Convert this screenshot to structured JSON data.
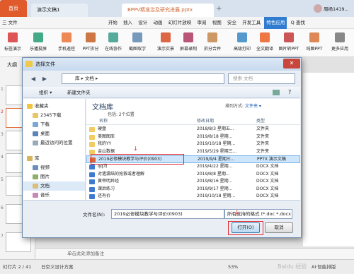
{
  "tabs": [
    {
      "label": "首页"
    },
    {
      "label": "演示文稿1"
    },
    {
      "label": "BPPV精准治及研究进展.pptx"
    }
  ],
  "user": "周扬1419...",
  "menu": [
    "三 文件",
    "开始",
    "插入",
    "设计",
    "动画",
    "幻灯片放映",
    "审阅",
    "视图",
    "安全",
    "开发工具",
    "特色应用",
    "Q 查找"
  ],
  "ribbon": [
    "标签演示",
    "乐播投屏",
    "手机遥控",
    "PPT拆分",
    "在线协作",
    "截图取字",
    "演示实景",
    "屏幕录制",
    "拆分合并",
    "高级打印",
    "全文翻译",
    "图片转PPT",
    "纯图PPT",
    "更多应用"
  ],
  "left_tab": "大纲",
  "slide_numbers": [
    "1",
    "2",
    "3",
    "4",
    "5",
    "6",
    "7"
  ],
  "dialog": {
    "title": "选择文件",
    "address": "库 ▸ 文档 ▸",
    "search": "搜索 文档",
    "organize": "组织 ▾",
    "new_folder": "新建文件夹",
    "nav": [
      {
        "label": "收藏夹",
        "indent": 1
      },
      {
        "label": "2345下载",
        "indent": 2
      },
      {
        "label": "下载",
        "indent": 2
      },
      {
        "label": "桌面",
        "indent": 2
      },
      {
        "label": "最近访问的位置",
        "indent": 2
      },
      {
        "label": "",
        "indent": 0
      },
      {
        "label": "库",
        "indent": 1
      },
      {
        "label": "视频",
        "indent": 2
      },
      {
        "label": "图片",
        "indent": 2
      },
      {
        "label": "文档",
        "indent": 2
      },
      {
        "label": "音乐",
        "indent": 2
      }
    ],
    "library_title": "文档库",
    "library_sub": "包括: 2个位置",
    "arrange_label": "排列方式:",
    "arrange_value": "文件夹 ▾",
    "columns": {
      "name": "名称",
      "date": "修改日期",
      "type": "类型"
    },
    "files": [
      {
        "name": "硬盘",
        "date": "2018/8/3 星期五...",
        "type": "文件夹"
      },
      {
        "name": "美图图库",
        "date": "2019/8/18 星期...",
        "type": "文件夹"
      },
      {
        "name": "我的YY",
        "date": "2019/10/18 星期...",
        "type": "文件夹"
      },
      {
        "name": "金山数据",
        "date": "2019/5/29 星期三...",
        "type": "文件夹"
      },
      {
        "name": "2019必修模块教学与评价(0903)",
        "date": "2019/9/4 星期三...",
        "type": "PPTX 演示文稿"
      },
      {
        "name": "qq为",
        "date": "2019/4/22 星期...",
        "type": "DOCX 文档"
      },
      {
        "name": "对遗漏结的抢救或者理解",
        "date": "2019/8/8 星期...",
        "type": "DOCX 文档"
      },
      {
        "name": "黄帝明异经",
        "date": "2019/8/16 星期...",
        "type": "DOCX 文档"
      },
      {
        "name": "课后练习",
        "date": "2019/9/17 星期...",
        "type": "DOCX 文档"
      },
      {
        "name": "还有价",
        "date": "2019/10/18 星期...",
        "type": "DOCX 文档"
      }
    ],
    "filename_label": "文件名(N):",
    "filename_value": "2019必修模块教学与评价(0903)",
    "filetype_value": "所有支持的格式 (*.doc *.docx",
    "open_button": "打开(O)",
    "cancel_button": "取消"
  },
  "notes_placeholder": "单击此处添加备注",
  "status": {
    "slide": "幻灯片 2 / 41",
    "theme": "日空义设计方案",
    "zoom": "53%",
    "ai": "AI·智能排版"
  },
  "watermark": "Baidu 经验"
}
